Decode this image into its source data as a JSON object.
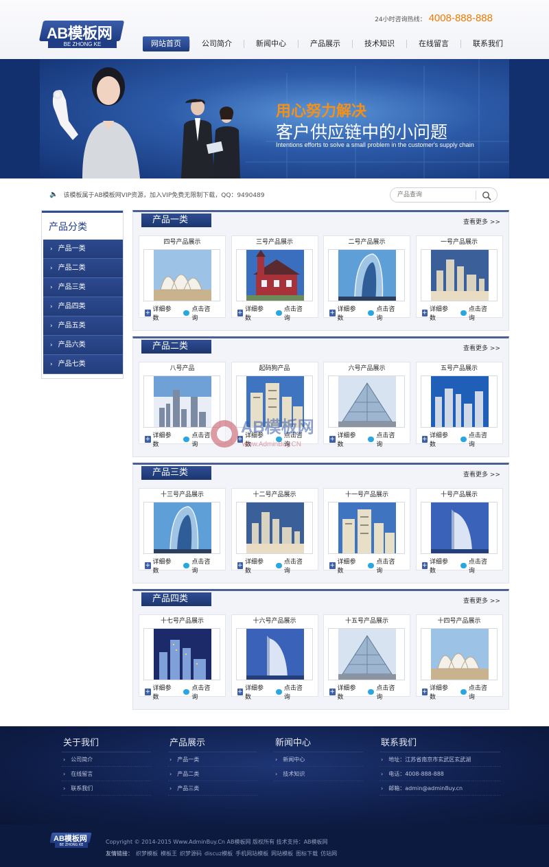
{
  "header": {
    "logo_text": "AB模板网",
    "logo_sub": "BE ZHONG KE",
    "hotline_label": "24小时咨询热线：",
    "hotline_number": "4008-888-888",
    "nav": [
      "网站首页",
      "公司简介",
      "新闻中心",
      "产品展示",
      "技术知识",
      "在线留言",
      "联系我们"
    ]
  },
  "banner": {
    "line1": "用心努力解决",
    "line2": "客户供应链中的小问题",
    "line3": "Intentions efforts to solve a small problem in the customer's supply chain"
  },
  "notice": "该模板属于AB模板网VIP资源，加入VIP免费无限制下载，QQ：9490489",
  "search": {
    "placeholder": "产品查询"
  },
  "sidebar": {
    "title": "产品分类",
    "items": [
      "产品一类",
      "产品二类",
      "产品三类",
      "产品四类",
      "产品五类",
      "产品六类",
      "产品七类"
    ]
  },
  "sections": [
    {
      "title": "产品一类",
      "more": "查看更多 >>",
      "cards": [
        {
          "name": "四号产品展示",
          "image": "opera-house"
        },
        {
          "name": "三号产品展示",
          "image": "red-house"
        },
        {
          "name": "二号产品展示",
          "image": "curved-tower"
        },
        {
          "name": "一号产品展示",
          "image": "beach-city"
        }
      ]
    },
    {
      "title": "产品二类",
      "more": "查看更多 >>",
      "cards": [
        {
          "name": "八号产品",
          "image": "skyline"
        },
        {
          "name": "起码狗产品",
          "image": "residential"
        },
        {
          "name": "六号产品展示",
          "image": "glass-pyramid"
        },
        {
          "name": "五号产品展示",
          "image": "city-blue"
        }
      ]
    },
    {
      "title": "产品三类",
      "more": "查看更多 >>",
      "cards": [
        {
          "name": "十三号产品展示",
          "image": "curved-tower"
        },
        {
          "name": "十二号产品展示",
          "image": "beach-city"
        },
        {
          "name": "十一号产品展示",
          "image": "residential"
        },
        {
          "name": "十号产品展示",
          "image": "sail-hotel"
        }
      ]
    },
    {
      "title": "产品四类",
      "more": "查看更多 >>",
      "cards": [
        {
          "name": "十七号产品展示",
          "image": "night-city"
        },
        {
          "name": "十六号产品展示",
          "image": "sail-hotel"
        },
        {
          "name": "十五号产品展示",
          "image": "glass-pyramid"
        },
        {
          "name": "十四号产品展示",
          "image": "opera-house"
        }
      ]
    }
  ],
  "card_buttons": {
    "detail": "详细参数",
    "consult": "点击咨询"
  },
  "watermark": {
    "text": "AB模板网",
    "url": "www.AdminBuy.CN"
  },
  "footer": {
    "cols": [
      {
        "title": "关于我们",
        "items": [
          "公司简介",
          "在线留言",
          "联系我们"
        ]
      },
      {
        "title": "产品展示",
        "items": [
          "产品一类",
          "产品二类",
          "产品三类"
        ]
      },
      {
        "title": "新闻中心",
        "items": [
          "新闻中心",
          "技术知识"
        ]
      },
      {
        "title": "联系我们",
        "items": [
          "地址：江苏省南京市玄武区玄武湖",
          "电话：4008-888-888",
          "邮箱：admin@admin8uy.cn"
        ]
      }
    ],
    "logo_text": "AB模板网",
    "logo_sub": "BE ZHONG KE",
    "copyright": "Copyright © 2014-2015 Www.AdminBuy.Cn AB模板网 版权所有  技术支持：AB模板网",
    "links_label": "友情链接：",
    "links": [
      "织梦模板",
      "模板王",
      "织梦源码",
      "discuz模板",
      "手机网站模板",
      "网站模板",
      "图标下载",
      "仿站网"
    ]
  }
}
